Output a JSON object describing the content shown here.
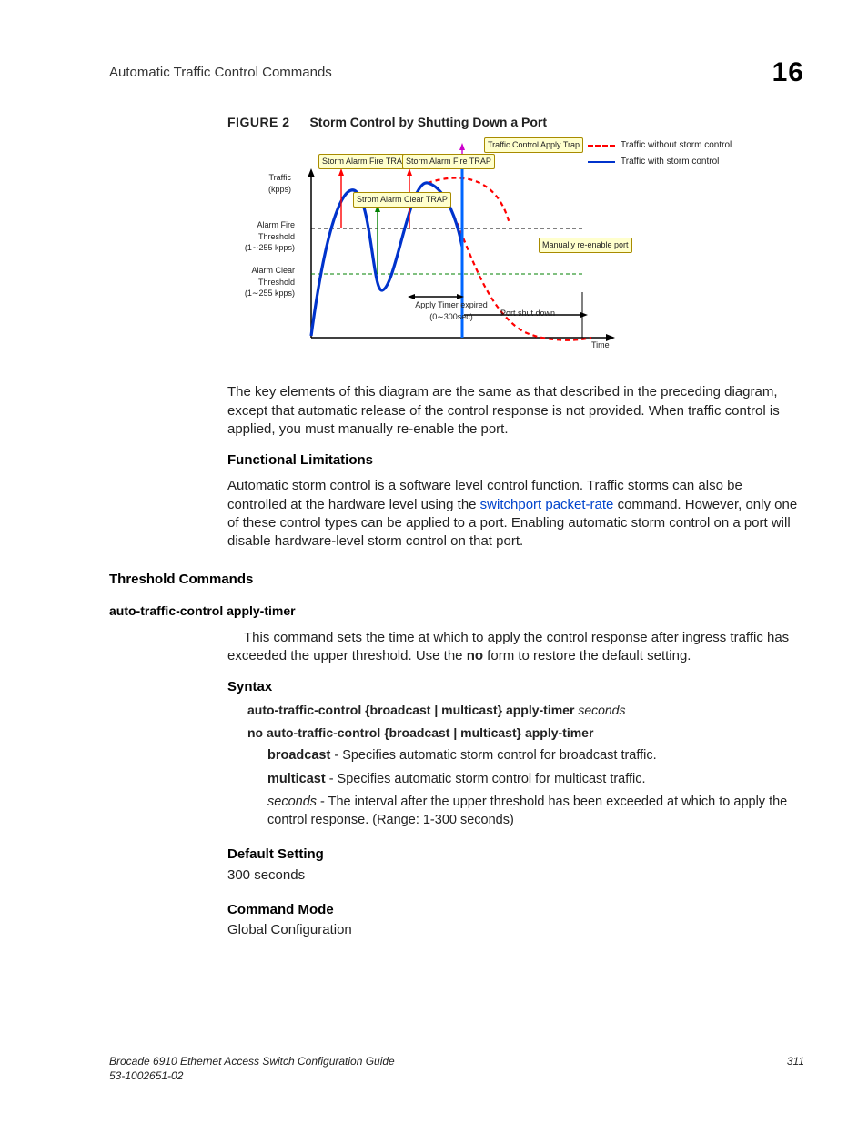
{
  "header": {
    "title": "Automatic Traffic Control Commands",
    "chapter": "16"
  },
  "figure": {
    "label": "FIGURE 2",
    "title": "Storm Control by Shutting Down a Port"
  },
  "diagram": {
    "y_label": "Traffic (kpps)",
    "thresh_fire": "Alarm Fire Threshold (1∼255 kpps)",
    "thresh_clear": "Alarm Clear Threshold (1∼255 kpps)",
    "box_storm_fire_1": "Storm Alarm Fire TRAP",
    "box_storm_clear": "Strom Alarm Clear TRAP",
    "box_storm_fire_2": "Storm Alarm Fire TRAP",
    "box_traffic_apply": "Traffic Control Apply Trap",
    "box_manual": "Manually re-enable port",
    "apply_timer": "Apply Timer expired (0∼300sec)",
    "port_shutdown": "Port shut down",
    "time_label": "Time",
    "legend_without": "Traffic without storm control",
    "legend_with": "Traffic with storm control"
  },
  "para_key": "The key elements of this diagram are the same as that described in the preceding diagram, except that automatic release of the control response is not provided. When traffic control is applied, you must manually re-enable the port.",
  "func_lim_heading": "Functional Limitations",
  "func_lim_text_a": "Automatic storm control is a software level control function. Traffic storms can also be controlled at the hardware level using the ",
  "func_lim_link": "switchport packet-rate",
  "func_lim_text_b": " command. However, only one of these control types can be applied to a port. Enabling automatic storm control on a port will disable hardware-level storm control on that port.",
  "threshold_heading": "Threshold Commands",
  "cmd_heading": "auto-traffic-control apply-timer",
  "cmd_desc_a": "This command sets the time at which to apply the control response after ingress traffic has exceeded the upper threshold. Use the ",
  "cmd_desc_no": "no",
  "cmd_desc_b": " form to restore the default setting.",
  "syntax_heading": "Syntax",
  "syntax1_a": "auto-traffic-control {broadcast | multicast} apply-timer ",
  "syntax1_b": "seconds",
  "syntax2": "no auto-traffic-control {broadcast | multicast} apply-timer",
  "param_broadcast_b": "broadcast",
  "param_broadcast_t": " - Specifies automatic storm control for broadcast traffic.",
  "param_multicast_b": "multicast",
  "param_multicast_t": " - Specifies automatic storm control for multicast traffic.",
  "param_seconds_i": "seconds",
  "param_seconds_t": " - The interval after the upper threshold has been exceeded at which to apply the control response. (Range: 1-300 seconds)",
  "default_heading": "Default Setting",
  "default_value": "300 seconds",
  "mode_heading": "Command Mode",
  "mode_value": "Global Configuration",
  "footer": {
    "book": "Brocade 6910 Ethernet Access Switch Configuration Guide",
    "docnum": "53-1002651-02",
    "pagenum": "311"
  },
  "chart_data": {
    "type": "line",
    "title": "Storm Control by Shutting Down a Port",
    "xlabel": "Time",
    "ylabel": "Traffic (kpps)",
    "ylim": [
      0,
      260
    ],
    "thresholds": {
      "alarm_fire": {
        "range": "1-255 kpps",
        "line": "dashed-black"
      },
      "alarm_clear": {
        "range": "1-255 kpps",
        "line": "dashed-green"
      }
    },
    "series": [
      {
        "name": "Traffic without storm control",
        "style": "dashed-red"
      },
      {
        "name": "Traffic with storm control",
        "style": "solid-blue"
      }
    ],
    "events": [
      "Storm Alarm Fire TRAP",
      "Storm Alarm Clear TRAP",
      "Storm Alarm Fire TRAP",
      "Traffic Control Apply Trap",
      "Apply Timer expired (0–300sec)",
      "Port shut down",
      "Manually re-enable port"
    ]
  }
}
